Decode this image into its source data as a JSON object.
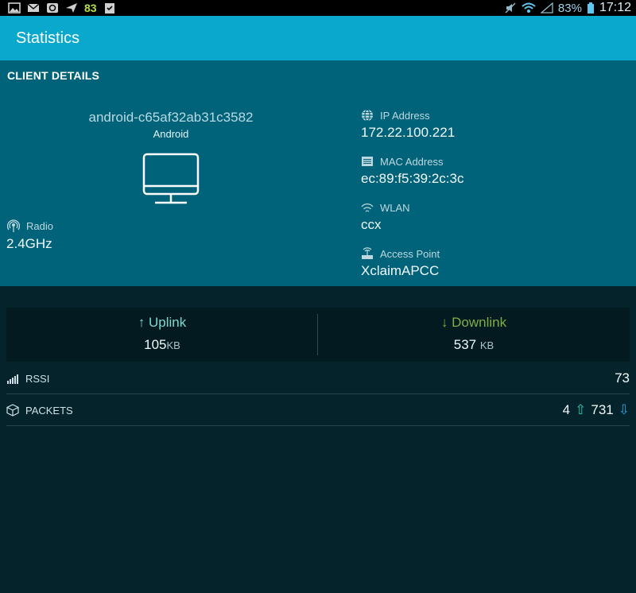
{
  "status_bar": {
    "battery_level": "83",
    "battery_percent": "83%",
    "time": "17:12",
    "colors": {
      "accent_green": "#b8e04a",
      "icons": "#9fd3ec"
    }
  },
  "app_bar": {
    "title": "Statistics",
    "color": "#0aa8cc"
  },
  "client_details": {
    "section_title": "CLIENT DETAILS",
    "hostname": "android-c65af32ab31c3582",
    "os": "Android",
    "device_icon": "monitor-icon",
    "radio": {
      "label": "Radio",
      "value": "2.4GHz",
      "icon": "radio-icon"
    },
    "ip": {
      "label": "IP Address",
      "value": "172.22.100.221",
      "icon": "globe-icon"
    },
    "mac": {
      "label": "MAC Address",
      "value": "ec:89:f5:39:2c:3c",
      "icon": "card-icon"
    },
    "wlan": {
      "label": "WLAN",
      "value": "ccx",
      "icon": "wifi-icon"
    },
    "access_point": {
      "label": "Access Point",
      "value": "XclaimAPCC",
      "icon": "router-icon"
    }
  },
  "traffic": {
    "uplink": {
      "arrow": "↑",
      "label": "Uplink",
      "value": "105",
      "unit": "KB",
      "color": "#7fd8cf"
    },
    "downlink": {
      "arrow": "↓",
      "label": "Downlink",
      "value": "537",
      "unit": "KB",
      "color": "#7fae47"
    }
  },
  "stats": {
    "rssi": {
      "label": "RSSI",
      "value": "73",
      "icon": "signal-bars-icon"
    },
    "packets": {
      "label": "PACKETS",
      "up": "4",
      "down": "731",
      "icon": "box-icon"
    }
  }
}
